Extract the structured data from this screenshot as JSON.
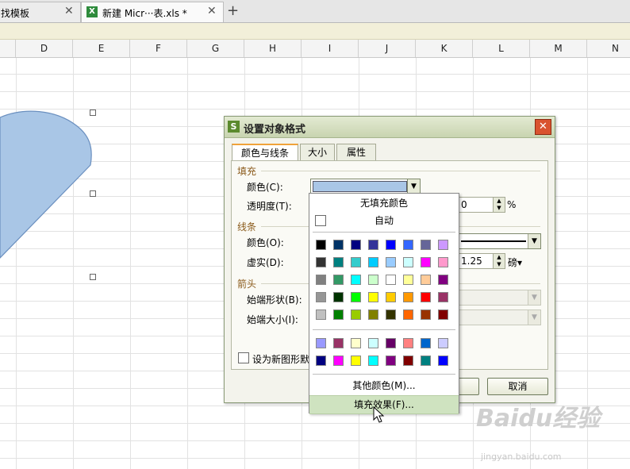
{
  "tabs": [
    {
      "label": "找模板"
    },
    {
      "label": "新建 Micr···表.xls *",
      "icon": "xls-icon"
    }
  ],
  "tab_close": "✕",
  "new_tab": "+",
  "columns": [
    "D",
    "E",
    "F",
    "G",
    "H",
    "I",
    "J",
    "K",
    "L",
    "M",
    "N"
  ],
  "dialog": {
    "title": "设置对象格式",
    "close": "✕",
    "tabs": [
      "颜色与线条",
      "大小",
      "属性"
    ],
    "fill_section": "填充",
    "color_label": "颜色(C):",
    "transparency_label": "透明度(T):",
    "transparency_value": "0",
    "percent": "%",
    "line_section": "线条",
    "line_color_label": "颜色(O):",
    "dash_label": "虚实(D):",
    "weight_value": "1.25",
    "weight_unit": "磅▾",
    "arrow_section": "箭头",
    "begin_style_label": "始端形状(B):",
    "begin_size_label": "始端大小(I):",
    "default_checkbox_label": "设为新图形默",
    "cancel": "取消"
  },
  "popup": {
    "no_fill": "无填充颜色",
    "auto": "自动",
    "more_colors": "其他颜色(M)...",
    "fill_effects": "填充效果(F)...",
    "main_colors": [
      "#000000",
      "#003366",
      "#000080",
      "#333399",
      "#0000ff",
      "#3366ff",
      "#666699",
      "#cc99ff",
      "#333333",
      "#008080",
      "#33cccc",
      "#00ccff",
      "#99ccff",
      "#ccffff",
      "#ff00ff",
      "#ff99cc",
      "#808080",
      "#339966",
      "#00ffff",
      "#ccffcc",
      "#ffffff",
      "#ffff99",
      "#ffcc99",
      "#800080",
      "#969696",
      "#003300",
      "#00ff00",
      "#ffff00",
      "#ffcc00",
      "#ff9900",
      "#ff0000",
      "#993366",
      "#c0c0c0",
      "#008000",
      "#99cc00",
      "#808000",
      "#333300",
      "#ff6600",
      "#993300",
      "#800000"
    ],
    "recent_colors": [
      "#9999ff",
      "#993366",
      "#ffffcc",
      "#ccffff",
      "#660066",
      "#ff8080",
      "#0066cc",
      "#ccccff",
      "#000080",
      "#ff00ff",
      "#ffff00",
      "#00ffff",
      "#800080",
      "#800000",
      "#008080",
      "#0000ff"
    ]
  },
  "watermark": "Baidu经验",
  "watermark_url": "jingyan.baidu.com",
  "colors": {
    "shape_fill": "#a9c6e6",
    "shape_stroke": "#6a8fbf"
  }
}
